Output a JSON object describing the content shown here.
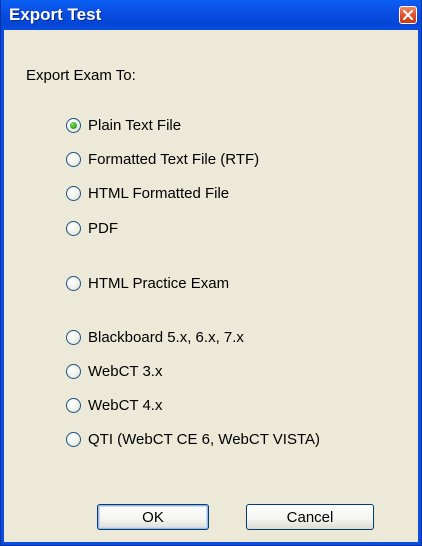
{
  "window": {
    "title": "Export Test",
    "title_bar_color": "#0a4ee0",
    "body_color": "#ece9d8",
    "close_icon": "close-icon"
  },
  "dialog": {
    "prompt": "Export Exam To:",
    "options": [
      {
        "label": "Plain Text File",
        "checked": true
      },
      {
        "label": "Formatted Text File (RTF)",
        "checked": false
      },
      {
        "label": "HTML Formatted File",
        "checked": false
      },
      {
        "label": "PDF",
        "checked": false
      },
      {
        "label": "HTML Practice Exam",
        "checked": false
      },
      {
        "label": "Blackboard 5.x, 6.x, 7.x",
        "checked": false
      },
      {
        "label": "WebCT 3.x",
        "checked": false
      },
      {
        "label": "WebCT 4.x",
        "checked": false
      },
      {
        "label": "QTI (WebCT CE 6, WebCT VISTA)",
        "checked": false
      }
    ]
  },
  "buttons": {
    "ok_label": "OK",
    "cancel_label": "Cancel"
  }
}
